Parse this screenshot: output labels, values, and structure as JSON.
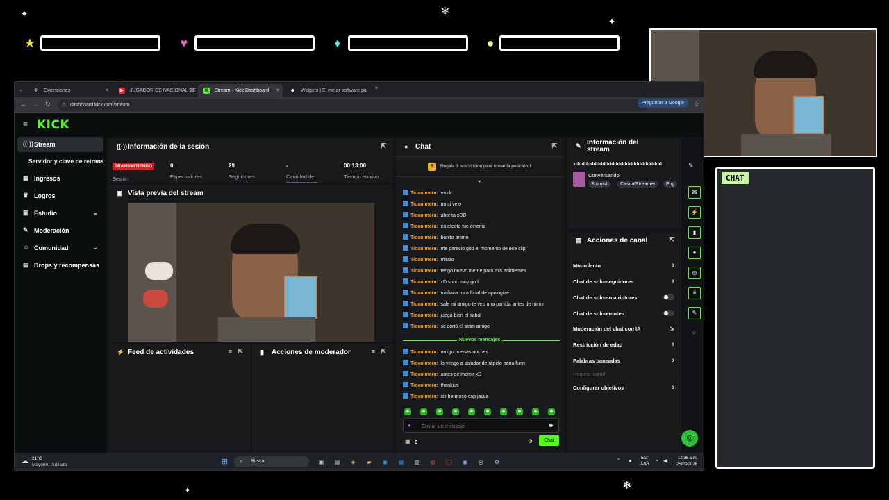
{
  "overlay": {
    "hud_icons": [
      "star-icon",
      "heart-icon",
      "diamond-icon",
      "coin-icon"
    ],
    "hud_colors": [
      "#f4e04d",
      "#e85fc4",
      "#4fe6d8",
      "#e8f08a"
    ],
    "chat_label": "CHAT"
  },
  "browser": {
    "tabs": [
      {
        "label": "Extensiones",
        "active": false
      },
      {
        "label": "JUGADOR DE NACIONAL DE",
        "active": false
      },
      {
        "label": "Stream - Kick Dashboard",
        "active": true
      },
      {
        "label": "Widgets | El mejor software pa",
        "active": false
      }
    ],
    "url": "dashboard.kick.com/stream",
    "google_button": "Preguntar a Google"
  },
  "app": {
    "logo": "KICK",
    "accent": "#53fc18"
  },
  "sidebar": {
    "items": [
      {
        "label": "Stream",
        "icon": "stream-icon",
        "active": true
      },
      {
        "label": "Servidor y clave de retransm",
        "icon": "",
        "active": false
      },
      {
        "label": "Ingresos",
        "icon": "money-icon",
        "active": false
      },
      {
        "label": "Logros",
        "icon": "trophy-icon",
        "active": false
      },
      {
        "label": "Estudio",
        "icon": "studio-icon",
        "active": false,
        "expandable": true
      },
      {
        "label": "Moderación",
        "icon": "wrench-icon",
        "active": false
      },
      {
        "label": "Comunidad",
        "icon": "people-icon",
        "active": false,
        "expandable": true
      },
      {
        "label": "Drops y recompensas",
        "icon": "gift-icon",
        "active": false
      }
    ]
  },
  "session": {
    "title": "Información de la sesión",
    "live_badge": "TRANSMITIENDO",
    "session_label": "Sesión",
    "stats": [
      {
        "value": "0",
        "label": "Espectadores"
      },
      {
        "value": "29",
        "label": "Seguidores"
      },
      {
        "value": "-",
        "label": "Cantidad de suscripciones"
      },
      {
        "value": "00:13:00",
        "label": "Tiempo en vivo"
      }
    ]
  },
  "preview": {
    "title": "Vista previa del stream"
  },
  "feed": {
    "title": "Feed de actividades"
  },
  "modactions": {
    "title": "Acciones de moderador"
  },
  "chat": {
    "title": "Chat",
    "gift_banner": "Regala 1 suscripción para tomar la posición 1",
    "username": "Tioanimeru",
    "messages_before": [
      "!en dc",
      "!no si velo",
      "!ahorita xDD",
      "!en efecto fue cinema",
      "!bonito anime",
      "!me parecio god el momento de ese clip",
      "!miralo",
      "!tengo nuevo meme para mis animemes",
      "!xD sono muy god",
      "!mañana toca flinal de apologize",
      "!sale mi amigo te veo una partida antes de mimir",
      "!juega bien el xabal",
      "!se cortó el strim amigo"
    ],
    "new_messages_label": "Nuevos mensajes",
    "messages_after": [
      "!amigo buenas noches",
      "!lo vengo a saludar de rápido pana furin",
      "!antes de momir xD",
      "!thankius",
      "!siii hermoso cap jajaja"
    ],
    "input_placeholder": "Enviar un mensaje",
    "viewer_count": "0",
    "send_button": "Chat"
  },
  "stream_info": {
    "title": "Información del stream",
    "stream_title": "xddddddddddddddddddddddddddddd",
    "category": "Conversando",
    "tags": [
      "Spanish",
      "CasualStreamer",
      "Eng"
    ]
  },
  "channel_actions": {
    "title": "Acciones de canal",
    "items": [
      {
        "label": "Modo lento",
        "kind": "arrow"
      },
      {
        "label": "Chat de solo-seguidores",
        "kind": "arrow"
      },
      {
        "label": "Chat de solo-suscriptores",
        "kind": "toggle"
      },
      {
        "label": "Chat de solo-emotes",
        "kind": "toggle"
      },
      {
        "label": "Moderación del chat con IA",
        "kind": "ext"
      },
      {
        "label": "Restricción de edad",
        "kind": "arrow"
      },
      {
        "label": "Palabras baneadas",
        "kind": "arrow"
      },
      {
        "label": "Hostear canal",
        "kind": "disabled"
      },
      {
        "label": "Configurar objetivos",
        "kind": "arrow"
      }
    ]
  },
  "taskbar": {
    "weather_temp": "21°C",
    "weather_desc": "Mayorm. nublado",
    "search": "Buscar",
    "lang": "ESP",
    "lang2": "LAA",
    "time": "12:36 a.m.",
    "date": "25/03/2026"
  }
}
